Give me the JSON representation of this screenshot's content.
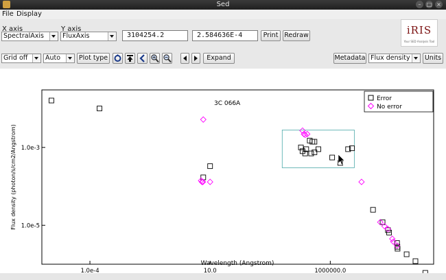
{
  "window": {
    "title": "Sed"
  },
  "menu": {
    "items": [
      "File",
      "Display"
    ]
  },
  "axes_controls": {
    "x_label": "X axis",
    "y_label": "Y axis",
    "x_value": "SpectralAxis",
    "y_value": "FluxAxis",
    "x_coord": "3104254.2",
    "y_coord": "2.584636E-4",
    "print_label": "Print",
    "redraw_label": "Redraw"
  },
  "logo": {
    "text": "iRIS",
    "subtitle": "Your SED Analysis Tool"
  },
  "toolbar": {
    "grid": "Grid off",
    "scale": "Auto",
    "plot_type": "Plot type",
    "expand": "Expand",
    "metadata": "Metadata",
    "units_type": "Flux density",
    "units": "Units"
  },
  "chart_data": {
    "type": "scatter",
    "title": "",
    "annotation": "3C 066A",
    "xlabel": "Wavelength (Angstrom)",
    "ylabel": "Flux density (photon/s/cm2/Angstrom)",
    "xscale": "log",
    "yscale": "log",
    "xlim": [
      1e-06,
      20000000000.0
    ],
    "ylim": [
      1e-06,
      0.03
    ],
    "x_ticks": [
      "1.0e-4",
      "10.0",
      "1000000.0"
    ],
    "y_ticks": [
      "1.0e-3",
      "1.0e-5"
    ],
    "legend": {
      "placement": "top-right",
      "entries": [
        "Error",
        "No error"
      ]
    },
    "selection_box": {
      "x": [
        10000,
        10000000
      ],
      "y": [
        0.0003,
        0.0028
      ]
    },
    "series": [
      {
        "name": "Error",
        "marker": "square",
        "color": "#000000",
        "points": [
          [
            2.5e-06,
            0.016
          ],
          [
            0.00025,
            0.01
          ],
          [
            5.2,
            0.00017
          ],
          [
            10,
            0.00033
          ],
          [
            60000,
            0.001
          ],
          [
            70000,
            0.0008
          ],
          [
            90000,
            0.0007
          ],
          [
            100000,
            0.0009
          ],
          [
            140000,
            0.0015
          ],
          [
            180000,
            0.0014
          ],
          [
            220000,
            0.0014
          ],
          [
            160000,
            0.0007
          ],
          [
            220000,
            0.00075
          ],
          [
            320000,
            0.0009
          ],
          [
            1200000,
            0.00055
          ],
          [
            2600000,
            0.0004
          ],
          [
            5500000,
            0.0009
          ],
          [
            8000000,
            0.00095
          ],
          [
            60000000,
            2.5e-05
          ],
          [
            150000000,
            1.2e-05
          ],
          [
            250000000,
            7.5e-06
          ],
          [
            280000000,
            6.5e-06
          ],
          [
            600000000,
            3.5e-06
          ],
          [
            620000000,
            2.8e-06
          ],
          [
            630000000,
            2.5e-06
          ],
          [
            1500000000,
            1.8e-06
          ],
          [
            3500000000,
            1.2e-06
          ],
          [
            9000000000,
            6e-07
          ]
        ]
      },
      {
        "name": "No error",
        "marker": "diamond",
        "color": "#ff00ff",
        "points": [
          [
            4.2,
            0.00014
          ],
          [
            4.6,
            0.00013
          ],
          [
            5,
            0.00013
          ],
          [
            10,
            0.00013
          ],
          [
            5.2,
            0.0052
          ],
          [
            70000,
            0.0027
          ],
          [
            80000,
            0.0022
          ],
          [
            90000,
            0.0021
          ],
          [
            110000,
            0.0022
          ],
          [
            20000000,
            0.00013
          ],
          [
            120000000,
            1.2e-05
          ],
          [
            180000000,
            9.5e-06
          ],
          [
            250000000,
            8e-06
          ],
          [
            380000000,
            4.5e-06
          ],
          [
            420000000,
            3.8e-06
          ],
          [
            600000000,
            3e-06
          ]
        ]
      }
    ]
  }
}
